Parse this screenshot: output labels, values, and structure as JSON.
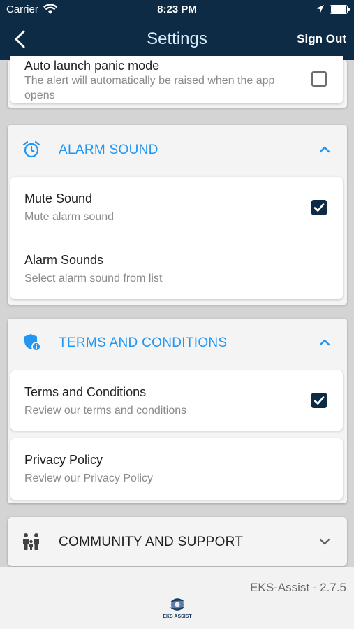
{
  "status_bar": {
    "carrier": "Carrier",
    "time": "8:23 PM"
  },
  "header": {
    "title": "Settings",
    "sign_out": "Sign Out"
  },
  "panic_section": {
    "item": {
      "title": "Auto launch panic mode",
      "subtitle": "The alert will automatically be raised when the app opens",
      "checked": false
    }
  },
  "alarm_section": {
    "heading": "ALARM SOUND",
    "icon": "alarm-clock-icon",
    "expanded": true,
    "items": [
      {
        "title": "Mute Sound",
        "subtitle": "Mute alarm sound",
        "checked": true
      },
      {
        "title": "Alarm Sounds",
        "subtitle": "Select alarm sound from list"
      }
    ]
  },
  "terms_section": {
    "heading": "TERMS AND CONDITIONS",
    "icon": "shield-icon",
    "expanded": true,
    "items": [
      {
        "title": "Terms and Conditions",
        "subtitle": "Review our terms and conditions",
        "checked": true
      },
      {
        "title": "Privacy Policy",
        "subtitle": "Review our Privacy Policy"
      }
    ]
  },
  "community_section": {
    "heading": "COMMUNITY AND SUPPORT",
    "icon": "family-icon",
    "expanded": false
  },
  "footer": {
    "version": "EKS-Assist - 2.7.5",
    "logo_text": "EKS ASSIST"
  },
  "colors": {
    "navy": "#0d2b45",
    "accent": "#2196f3",
    "title_text": "#d9eefc"
  }
}
